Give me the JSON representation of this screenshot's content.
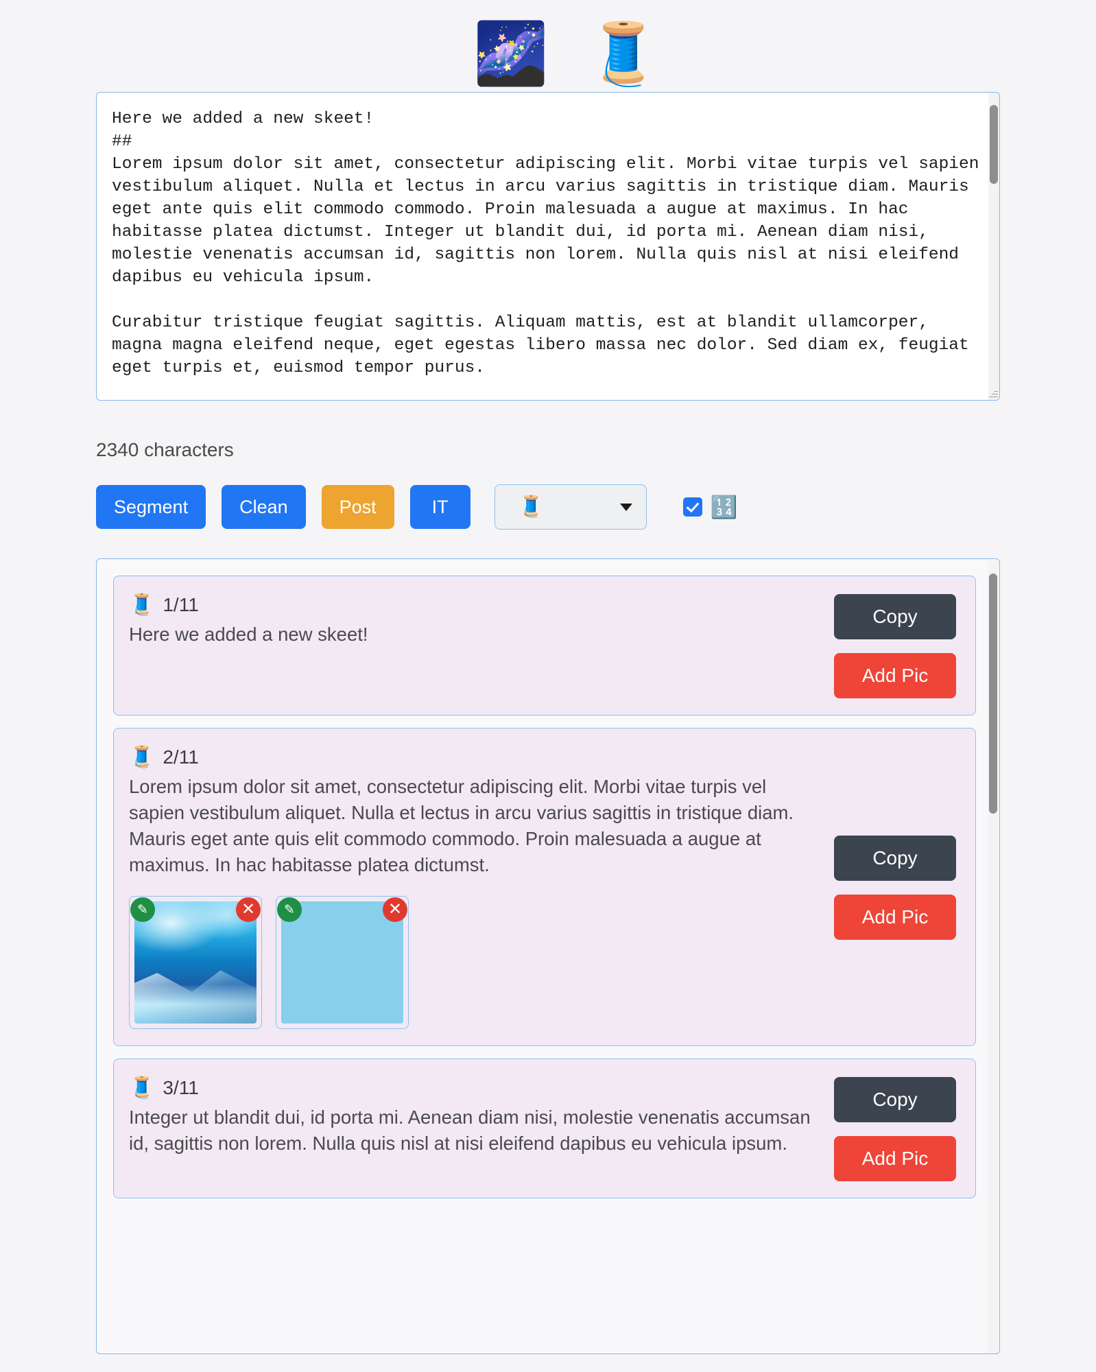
{
  "header": {
    "galaxy_emoji": "🌌",
    "thread_emoji": "🧵"
  },
  "editor": {
    "value": "Here we added a new skeet!\n##\nLorem ipsum dolor sit amet, consectetur adipiscing elit. Morbi vitae turpis vel sapien vestibulum aliquet. Nulla et lectus in arcu varius sagittis in tristique diam. Mauris eget ante quis elit commodo commodo. Proin malesuada a augue at maximus. In hac habitasse platea dictumst. Integer ut blandit dui, id porta mi. Aenean diam nisi, molestie venenatis accumsan id, sagittis non lorem. Nulla quis nisl at nisi eleifend dapibus eu vehicula ipsum.\n\nCurabitur tristique feugiat sagittis. Aliquam mattis, est at blandit ullamcorper, magna magna eleifend neque, eget egestas libero massa nec dolor. Sed diam ex, feugiat eget turpis et, euismod tempor purus."
  },
  "charcount": {
    "label": "2340 characters"
  },
  "toolbar": {
    "segment_label": "Segment",
    "clean_label": "Clean",
    "post_label": "Post",
    "it_label": "IT",
    "thread_select_value": "🧵",
    "numbers_emoji": "🔢"
  },
  "segments": [
    {
      "index": "1/11",
      "spool": "🧵",
      "text": "Here we added a new skeet!",
      "copy_label": "Copy",
      "addpic_label": "Add Pic",
      "images": []
    },
    {
      "index": "2/11",
      "spool": "🧵",
      "text": "Lorem ipsum dolor sit amet, consectetur adipiscing elit. Morbi vitae turpis vel sapien vestibulum aliquet. Nulla et lectus in arcu varius sagittis in tristique diam. Mauris eget ante quis elit commodo commodo. Proin malesuada a augue at maximus. In hac habitasse platea dictumst.",
      "copy_label": "Copy",
      "addpic_label": "Add Pic",
      "images": [
        {
          "style": "aurora",
          "edit_icon": "✎",
          "delete_icon": "✕"
        },
        {
          "style": "plain",
          "edit_icon": "✎",
          "delete_icon": "✕"
        }
      ]
    },
    {
      "index": "3/11",
      "spool": "🧵",
      "text": "Integer ut blandit dui, id porta mi. Aenean diam nisi, molestie venenatis accumsan id, sagittis non lorem. Nulla quis nisl at nisi eleifend dapibus eu vehicula ipsum.",
      "copy_label": "Copy",
      "addpic_label": "Add Pic",
      "images": []
    }
  ],
  "colors": {
    "primary_blue": "#2176f3",
    "orange": "#eda431",
    "copy_dark": "#3c4450",
    "addpic_red": "#ef4438",
    "card_bg": "#f2e9f5",
    "border_blue": "#8fc0ec",
    "page_bg": "#f5f5f7"
  }
}
